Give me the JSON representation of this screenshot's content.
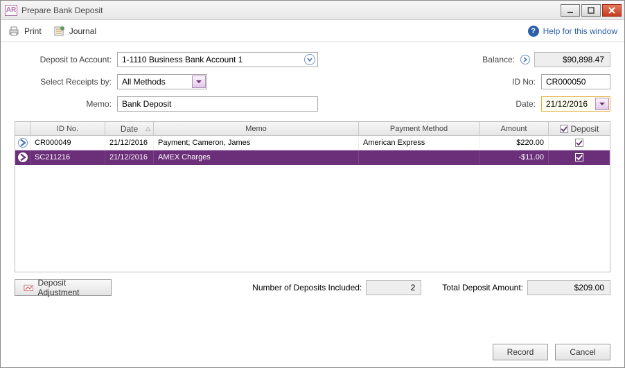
{
  "window": {
    "title": "Prepare Bank Deposit",
    "app_badge": "AR"
  },
  "toolbar": {
    "print_label": "Print",
    "journal_label": "Journal",
    "help_label": "Help for this window"
  },
  "form": {
    "deposit_account_label": "Deposit to Account:",
    "deposit_account_value": "1-1110 Business Bank Account 1",
    "balance_label": "Balance:",
    "balance_value": "$90,898.47",
    "select_receipts_label": "Select Receipts by:",
    "select_receipts_value": "All Methods",
    "id_no_label": "ID No:",
    "id_no_value": "CR000050",
    "memo_label": "Memo:",
    "memo_value": "Bank Deposit",
    "date_label": "Date:",
    "date_value": "21/12/2016"
  },
  "grid": {
    "headers": {
      "id": "ID No.",
      "date": "Date",
      "memo": "Memo",
      "payment_method": "Payment Method",
      "amount": "Amount",
      "deposit": "Deposit"
    },
    "rows": [
      {
        "id": "CR000049",
        "date": "21/12/2016",
        "memo": "Payment; Cameron, James",
        "payment_method": "American Express",
        "amount": "$220.00",
        "deposit": true,
        "selected": false
      },
      {
        "id": "SC211216",
        "date": "21/12/2016",
        "memo": "AMEX Charges",
        "payment_method": "",
        "amount": "-$11.00",
        "deposit": true,
        "selected": true
      }
    ]
  },
  "summary": {
    "deposit_adjustment_label": "Deposit Adjustment",
    "num_deposits_label": "Number of Deposits Included:",
    "num_deposits_value": "2",
    "total_label": "Total Deposit Amount:",
    "total_value": "$209.00"
  },
  "footer": {
    "record_label": "Record",
    "cancel_label": "Cancel"
  }
}
